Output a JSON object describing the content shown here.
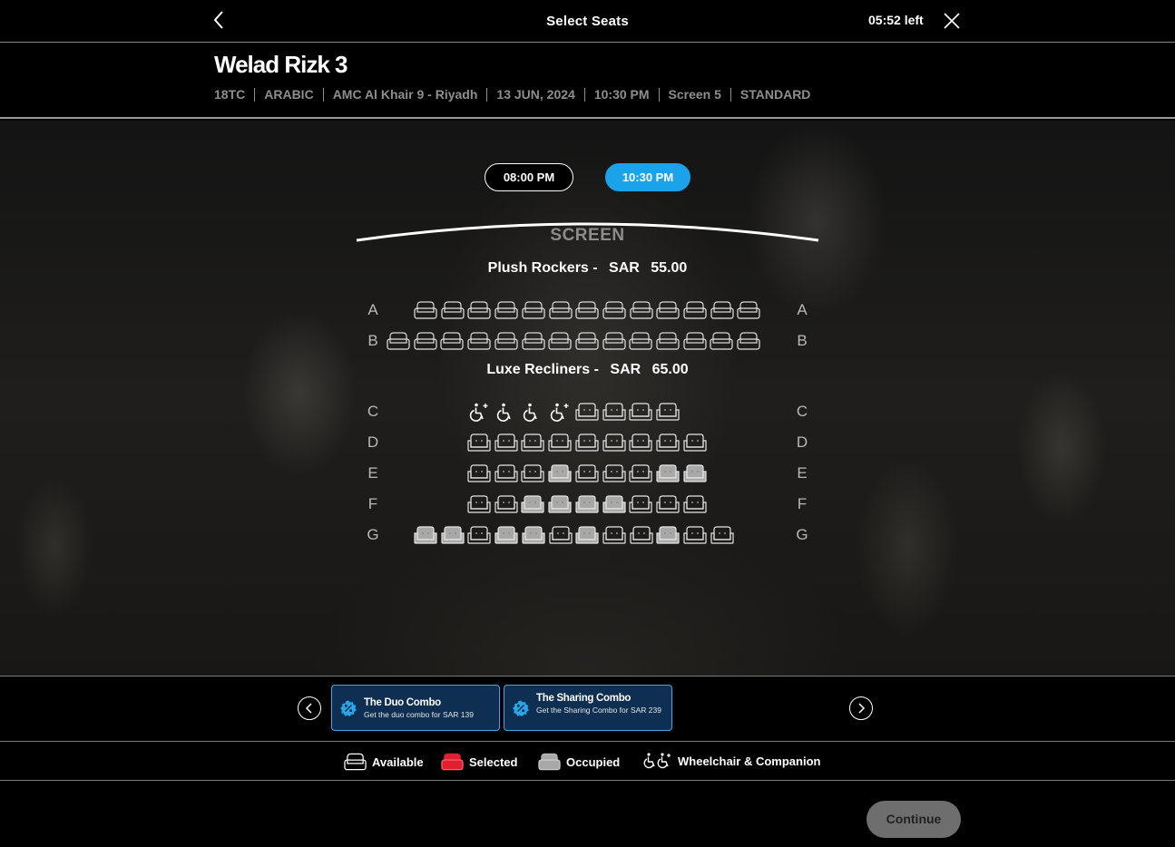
{
  "topbar": {
    "title": "Select Seats",
    "timer": "05:52 left"
  },
  "movie": {
    "title": "Welad Rizk 3",
    "meta": [
      "18TC",
      "ARABIC",
      "AMC Al Khair 9 - Riyadh",
      "13 JUN, 2024",
      "10:30 PM",
      "Screen 5",
      "STANDARD"
    ]
  },
  "showtimes": {
    "inactive": "08:00 PM",
    "active": "10:30 PM"
  },
  "screen_label": "SCREEN",
  "sections": [
    {
      "name": "Plush Rockers -",
      "currency": "SAR",
      "price": "55.00"
    },
    {
      "name": "Luxe Recliners -",
      "currency": "SAR",
      "price": "65.00"
    }
  ],
  "rows": [
    {
      "label": "A",
      "seats": [
        "available",
        "available",
        "available",
        "available",
        "available",
        "available",
        "available",
        "available",
        "available",
        "available",
        "available",
        "available",
        "available"
      ]
    },
    {
      "label": "B",
      "seats": [
        "available",
        "available",
        "available",
        "available",
        "available",
        "available",
        "available",
        "available",
        "available",
        "available",
        "available",
        "available",
        "available",
        "available"
      ]
    },
    {
      "label": "C",
      "seats": [
        "wheelchair-companion",
        "wheelchair",
        "wheelchair",
        "wheelchair-companion",
        "available",
        "available",
        "available",
        "available"
      ]
    },
    {
      "label": "D",
      "seats": [
        "available",
        "available",
        "available",
        "available",
        "available",
        "available",
        "available",
        "available",
        "available"
      ]
    },
    {
      "label": "E",
      "seats": [
        "available",
        "available",
        "available",
        "occupied",
        "available",
        "available",
        "available",
        "occupied",
        "occupied"
      ]
    },
    {
      "label": "F",
      "seats": [
        "available",
        "available",
        "occupied",
        "occupied",
        "occupied",
        "occupied",
        "available",
        "available",
        "available"
      ]
    },
    {
      "label": "G",
      "seats": [
        "occupied",
        "occupied",
        "available",
        "occupied",
        "occupied",
        "available",
        "occupied",
        "available",
        "available",
        "occupied",
        "available",
        "available"
      ]
    }
  ],
  "combos": [
    {
      "name": "The Duo Combo",
      "desc": "Get the duo combo for SAR 139"
    },
    {
      "name": "The Sharing Combo",
      "desc": "Get the Sharing Combo for SAR 239"
    }
  ],
  "legend": {
    "available": "Available",
    "selected": "Selected",
    "occupied": "Occupied",
    "wheelchair": "Wheelchair & Companion"
  },
  "colors": {
    "accent": "#1aa3e8",
    "selected": "#e0202e",
    "occupied": "#a8a8a8",
    "combo_bg": "#0e2e52"
  },
  "continue_label": "Continue"
}
